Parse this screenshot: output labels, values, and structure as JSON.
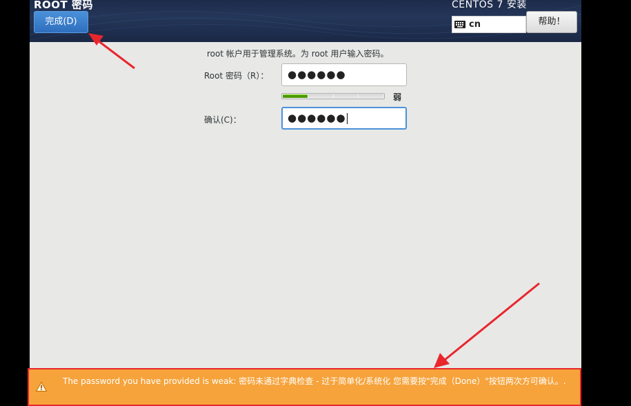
{
  "header": {
    "spoke_title": "ROOT 密码",
    "done_label": "完成(D)",
    "product_title": "CENTOS 7 安装",
    "keyboard_layout": "cn",
    "help_label": "帮助！"
  },
  "form": {
    "intro": "root 帐户用于管理系统。为 root 用户输入密码。",
    "root_password_label": "Root 密码（R）：",
    "root_password_value": "●●●●●●",
    "strength_level": 1,
    "strength_segments": 4,
    "strength_label": "弱",
    "confirm_label": "确认(C)：",
    "confirm_value": "●●●●●●"
  },
  "warning": {
    "text": "The password you have provided is weak: 密码未通过字典检查 - 过于简单化/系统化 您需要按\"完成（Done）\"按钮两次方可确认。."
  },
  "colors": {
    "header_bg": "#1d2b4a",
    "done_button": "#3b80cf",
    "warning_bg": "#f6a33b",
    "warning_border": "#e8262c",
    "strength_fill": "#4e9a06",
    "annotation_arrow": "#e8262c"
  },
  "icons": {
    "keyboard": "keyboard-icon",
    "warning": "warning-icon"
  }
}
